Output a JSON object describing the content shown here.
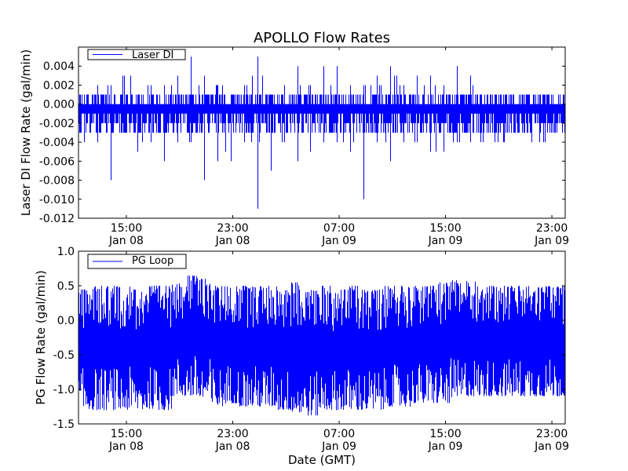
{
  "chart_data": [
    {
      "type": "line",
      "title": "APOLLO Flow Rates",
      "xlabel": "",
      "ylabel": "Laser DI Flow Rate (gal/min)",
      "xlim_hours_from_jan08_0000": [
        11.4,
        48.0
      ],
      "ylim": [
        -0.012,
        0.006
      ],
      "yticks": [
        "0.004",
        "0.002",
        "0.000",
        "-0.002",
        "-0.004",
        "-0.006",
        "-0.008",
        "-0.010",
        "-0.012"
      ],
      "ytick_values": [
        0.004,
        0.002,
        0.0,
        -0.002,
        -0.004,
        -0.006,
        -0.008,
        -0.01,
        -0.012
      ],
      "xticks": [
        {
          "time": "15:00",
          "date": "Jan 08",
          "hours": 15
        },
        {
          "time": "23:00",
          "date": "Jan 08",
          "hours": 23
        },
        {
          "time": "07:00",
          "date": "Jan 09",
          "hours": 31
        },
        {
          "time": "15:00",
          "date": "Jan 09",
          "hours": 39
        },
        {
          "time": "23:00",
          "date": "Jan 09",
          "hours": 47
        }
      ],
      "legend": {
        "label": "Laser DI",
        "placement": "top-left"
      },
      "color": "#0000ff",
      "series": [
        {
          "name": "Laser DI",
          "note": "hourly envelope (min,max) of dense signal; core band -0.003..0.001",
          "bin_hours": [
            11.9,
            12.9,
            13.9,
            14.9,
            15.9,
            16.9,
            17.9,
            18.9,
            19.9,
            20.9,
            21.9,
            22.9,
            23.9,
            24.9,
            25.9,
            26.9,
            27.9,
            28.9,
            29.9,
            30.9,
            31.9,
            32.9,
            33.9,
            34.9,
            35.9,
            36.9,
            37.9,
            38.9,
            39.9,
            40.9,
            41.7
          ],
          "min": [
            -0.004,
            -0.004,
            -0.008,
            -0.003,
            -0.005,
            -0.004,
            -0.006,
            -0.004,
            -0.004,
            -0.008,
            -0.006,
            -0.006,
            -0.004,
            -0.011,
            -0.007,
            -0.004,
            -0.006,
            -0.005,
            -0.004,
            -0.004,
            -0.005,
            -0.01,
            -0.004,
            -0.006,
            -0.004,
            -0.004,
            -0.005,
            -0.005,
            -0.004,
            -0.004,
            -0.004
          ],
          "max": [
            0.001,
            0.002,
            0.002,
            0.003,
            0.001,
            0.002,
            0.002,
            0.003,
            0.005,
            0.003,
            0.002,
            0.001,
            0.002,
            0.005,
            0.001,
            0.002,
            0.004,
            0.002,
            0.004,
            0.004,
            0.002,
            0.002,
            0.003,
            0.004,
            0.002,
            0.003,
            0.003,
            0.002,
            0.004,
            0.003,
            0.001
          ]
        }
      ]
    },
    {
      "type": "line",
      "title": "",
      "xlabel": "Date (GMT)",
      "ylabel": "PG Flow Rate (gal/min)",
      "xlim_hours_from_jan08_0000": [
        11.4,
        48.0
      ],
      "ylim": [
        -1.5,
        1.0
      ],
      "yticks": [
        "1.0",
        "0.5",
        "0.0",
        "-0.5",
        "-1.0",
        "-1.5"
      ],
      "ytick_values": [
        1.0,
        0.5,
        0.0,
        -0.5,
        -1.0,
        -1.5
      ],
      "xticks": [
        {
          "time": "15:00",
          "date": "Jan 08",
          "hours": 15
        },
        {
          "time": "23:00",
          "date": "Jan 08",
          "hours": 23
        },
        {
          "time": "07:00",
          "date": "Jan 09",
          "hours": 31
        },
        {
          "time": "15:00",
          "date": "Jan 09",
          "hours": 39
        },
        {
          "time": "23:00",
          "date": "Jan 09",
          "hours": 47
        }
      ],
      "legend": {
        "label": "PG Loop",
        "placement": "top-left"
      },
      "color": "#0000ff",
      "series": [
        {
          "name": "PG Loop",
          "note": "hourly envelope (min,max) of dense signal",
          "bin_hours": [
            11.9,
            12.9,
            13.9,
            14.9,
            15.9,
            16.9,
            17.9,
            18.9,
            19.9,
            20.9,
            21.9,
            22.9,
            23.9,
            24.9,
            25.9,
            26.9,
            27.9,
            28.9,
            29.9,
            30.9,
            31.9,
            32.9,
            33.9,
            34.9,
            35.9,
            36.9,
            37.9,
            38.9,
            39.9,
            40.9,
            41.7
          ],
          "min": [
            -1.3,
            -1.3,
            -1.3,
            -1.3,
            -1.3,
            -1.28,
            -1.3,
            -1.1,
            -1.1,
            -1.15,
            -1.25,
            -1.2,
            -1.25,
            -1.25,
            -1.25,
            -1.3,
            -1.35,
            -1.38,
            -1.3,
            -1.3,
            -1.3,
            -1.3,
            -1.3,
            -1.25,
            -1.25,
            -1.2,
            -1.2,
            -1.2,
            -1.15,
            -1.1,
            -1.1
          ],
          "max": [
            0.45,
            0.5,
            0.5,
            0.5,
            0.45,
            0.5,
            0.5,
            0.62,
            0.65,
            0.6,
            0.5,
            0.5,
            0.5,
            0.5,
            0.5,
            0.45,
            0.55,
            0.45,
            0.5,
            0.45,
            0.5,
            0.45,
            0.45,
            0.5,
            0.5,
            0.5,
            0.5,
            0.55,
            0.58,
            0.6,
            0.5
          ]
        }
      ]
    }
  ]
}
